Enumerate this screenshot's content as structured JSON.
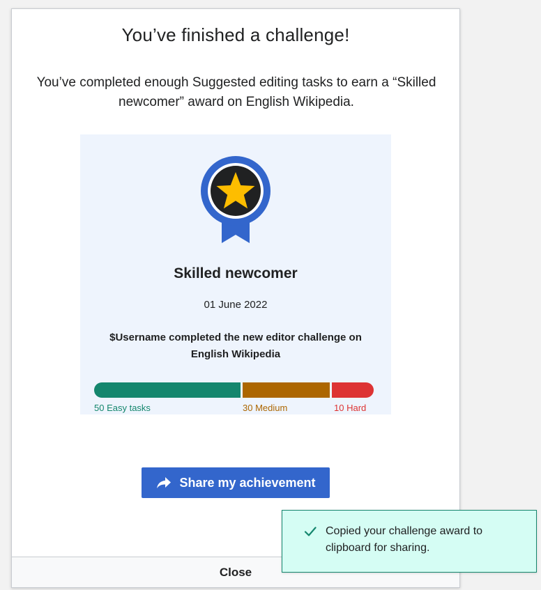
{
  "dialog": {
    "title": "You’ve finished a challenge!",
    "description": "You’ve completed enough Suggested editing tasks to earn a “Skilled newcomer” award on English Wikipedia."
  },
  "award": {
    "icon": "award-ribbon-star-icon",
    "name": "Skilled newcomer",
    "date": "01 June 2022",
    "text": "$Username completed the new editor challenge on English Wikipedia",
    "progress": {
      "easy_count": 50,
      "medium_count": 30,
      "hard_count": 10,
      "easy_label": "50 Easy tasks",
      "medium_label": "30 Medium",
      "hard_label": "10 Hard"
    },
    "colors": {
      "easy": "#14866d",
      "medium": "#ac6600",
      "hard": "#dd3333",
      "ribbon": "#3366cc",
      "star": "#fdbd00",
      "card_bg": "#eef4fd"
    }
  },
  "actions": {
    "share_label": "Share my achievement",
    "share_icon": "share-arrow-icon",
    "close_label": "Close"
  },
  "toast": {
    "icon": "check-icon",
    "message": "Copied your challenge award to clipboard for sharing."
  }
}
